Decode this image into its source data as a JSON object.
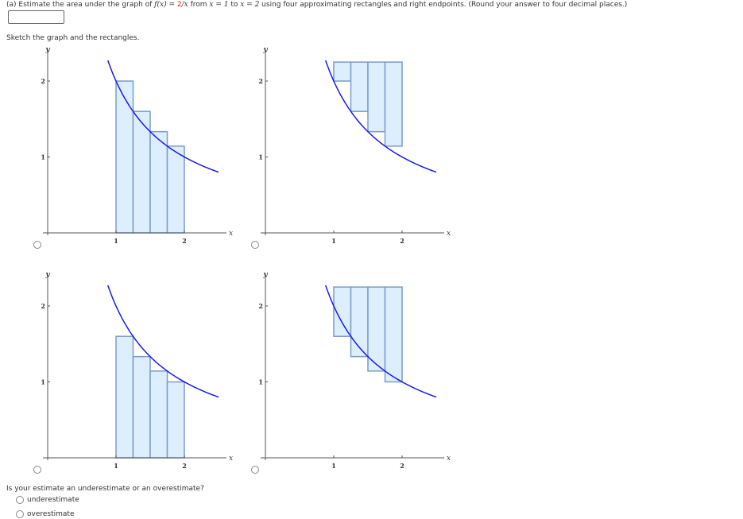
{
  "question": {
    "prefix": "(a) Estimate the area under the graph of ",
    "fx": "f(x) = ",
    "num": "2",
    "rest_fn": "/x",
    "from": " from ",
    "x1": "x = 1",
    "to": " to ",
    "x2": "x = 2",
    "suffix": " using four approximating rectangles and right endpoints. (Round your answer to four decimal places.)"
  },
  "answer_value": "",
  "sketch_label": "Sketch the graph and the rectangles.",
  "colors": {
    "curve": "#1a1aee",
    "rect_fill": "#ddeeff",
    "rect_stroke": "#7a9cc8",
    "axis": "#555555"
  },
  "chart_data": [
    {
      "type": "area",
      "name": "graph-option-1",
      "function": "2/x",
      "x_range": [
        0.88,
        2.5
      ],
      "xlim": [
        0,
        2.5
      ],
      "ylim": [
        0,
        2.25
      ],
      "xticks": [
        "1",
        "2"
      ],
      "yticks": [
        "1",
        "2"
      ],
      "xlabel": "x",
      "ylabel": "y",
      "rectangles": [
        {
          "x0": 1,
          "x1": 1.25,
          "y0": 0,
          "y1": 2
        },
        {
          "x0": 1.25,
          "x1": 1.5,
          "y0": 0,
          "y1": 1.6
        },
        {
          "x0": 1.5,
          "x1": 1.75,
          "y0": 0,
          "y1": 1.3333
        },
        {
          "x0": 1.75,
          "x1": 2,
          "y0": 0,
          "y1": 1.1429
        }
      ]
    },
    {
      "type": "area",
      "name": "graph-option-2",
      "function": "2/x",
      "x_range": [
        0.88,
        2.5
      ],
      "xlim": [
        0,
        2.5
      ],
      "ylim": [
        0,
        2.25
      ],
      "xticks": [
        "1",
        "2"
      ],
      "yticks": [
        "1",
        "2"
      ],
      "xlabel": "x",
      "ylabel": "y",
      "rectangles": [
        {
          "x0": 1,
          "x1": 1.25,
          "y0": 2,
          "y1": 2.25
        },
        {
          "x0": 1.25,
          "x1": 1.5,
          "y0": 1.6,
          "y1": 2.25
        },
        {
          "x0": 1.5,
          "x1": 1.75,
          "y0": 1.3333,
          "y1": 2.25
        },
        {
          "x0": 1.75,
          "x1": 2,
          "y0": 1.1429,
          "y1": 2.25
        }
      ]
    },
    {
      "type": "area",
      "name": "graph-option-3",
      "function": "2/x",
      "x_range": [
        0.88,
        2.5
      ],
      "xlim": [
        0,
        2.5
      ],
      "ylim": [
        0,
        2.25
      ],
      "xticks": [
        "1",
        "2"
      ],
      "yticks": [
        "1",
        "2"
      ],
      "xlabel": "x",
      "ylabel": "y",
      "rectangles": [
        {
          "x0": 1,
          "x1": 1.25,
          "y0": 0,
          "y1": 1.6
        },
        {
          "x0": 1.25,
          "x1": 1.5,
          "y0": 0,
          "y1": 1.3333
        },
        {
          "x0": 1.5,
          "x1": 1.75,
          "y0": 0,
          "y1": 1.1429
        },
        {
          "x0": 1.75,
          "x1": 2,
          "y0": 0,
          "y1": 1
        }
      ]
    },
    {
      "type": "area",
      "name": "graph-option-4",
      "function": "2/x",
      "x_range": [
        0.88,
        2.5
      ],
      "xlim": [
        0,
        2.5
      ],
      "ylim": [
        0,
        2.25
      ],
      "xticks": [
        "1",
        "2"
      ],
      "yticks": [
        "1",
        "2"
      ],
      "xlabel": "x",
      "ylabel": "y",
      "rectangles": [
        {
          "x0": 1,
          "x1": 1.25,
          "y0": 1.6,
          "y1": 2.25
        },
        {
          "x0": 1.25,
          "x1": 1.5,
          "y0": 1.3333,
          "y1": 2.25
        },
        {
          "x0": 1.5,
          "x1": 1.75,
          "y0": 1.1429,
          "y1": 2.25
        },
        {
          "x0": 1.75,
          "x1": 2,
          "y0": 1,
          "y1": 2.25
        }
      ]
    }
  ],
  "estimate_question": "Is your estimate an underestimate or an overestimate?",
  "options": [
    "underestimate",
    "overestimate"
  ]
}
